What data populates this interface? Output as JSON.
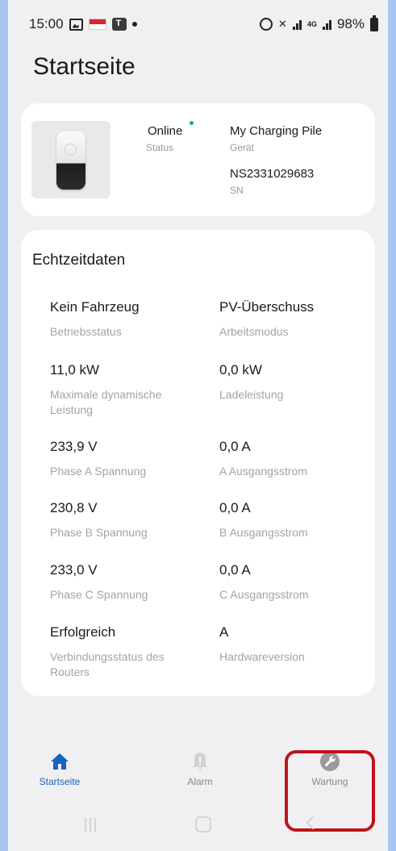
{
  "status_bar": {
    "time": "15:00",
    "battery": "98%",
    "network": "4G"
  },
  "page": {
    "title": "Startseite"
  },
  "device": {
    "status_value": "Online",
    "status_label": "Status",
    "device_value": "My Charging Pile",
    "device_label": "Gerät",
    "sn_value": "NS2331029683",
    "sn_label": "SN",
    "status_dot_color": "#22b14c"
  },
  "realtime": {
    "title": "Echtzeitdaten",
    "items": [
      {
        "value": "Kein Fahrzeug",
        "label": "Betriebsstatus"
      },
      {
        "value": "PV-Überschuss",
        "label": "Arbeitsmodus"
      },
      {
        "value": "11,0 kW",
        "label": "Maximale dynamische Leistung"
      },
      {
        "value": "0,0 kW",
        "label": "Ladeleistung"
      },
      {
        "value": "233,9 V",
        "label": "Phase A Spannung"
      },
      {
        "value": "0,0 A",
        "label": "A Ausgangsstrom"
      },
      {
        "value": "230,8 V",
        "label": "Phase B Spannung"
      },
      {
        "value": "0,0 A",
        "label": "B Ausgangsstrom"
      },
      {
        "value": "233,0 V",
        "label": "Phase C Spannung"
      },
      {
        "value": "0,0 A",
        "label": "C Ausgangsstrom"
      },
      {
        "value": "Erfolgreich",
        "label": "Verbindungsstatus des Routers"
      },
      {
        "value": "A",
        "label": "Hardwareversion"
      }
    ]
  },
  "bottom_nav": {
    "items": [
      {
        "label": "Startseite",
        "icon": "home-icon",
        "active": true
      },
      {
        "label": "Alarm",
        "icon": "alarm-bell-icon",
        "active": false
      },
      {
        "label": "Wartung",
        "icon": "wrench-icon",
        "active": false
      }
    ]
  },
  "colors": {
    "accent": "#1565c0",
    "highlight": "#c0121c",
    "background": "#f0f0f2"
  }
}
